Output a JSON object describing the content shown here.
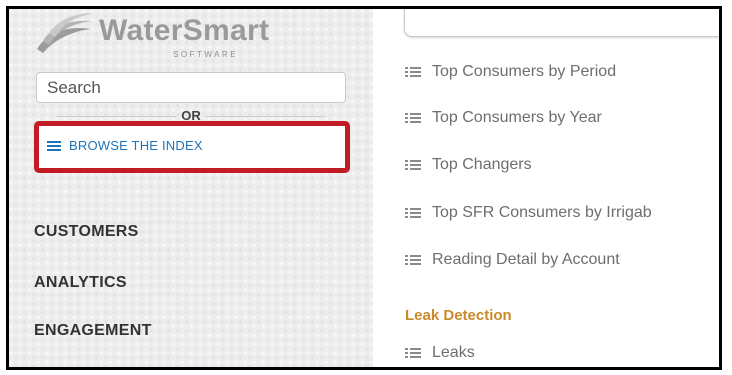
{
  "brand": {
    "name": "WaterSmart",
    "tagline": "SOFTWARE",
    "logo_icon": "water-waves-logo-icon"
  },
  "sidebar": {
    "search": {
      "placeholder": "Search",
      "value": ""
    },
    "or_label": "OR",
    "browse": {
      "label": "BROWSE THE INDEX",
      "icon": "hamburger-menu-icon",
      "highlight_color": "#c11c26",
      "link_color": "#1f73b7"
    },
    "nav": [
      {
        "label": "CUSTOMERS"
      },
      {
        "label": "ANALYTICS"
      },
      {
        "label": "ENGAGEMENT"
      }
    ]
  },
  "main": {
    "reports": [
      {
        "label": "Top Consumers by Period",
        "icon": "list-icon"
      },
      {
        "label": "Top Consumers by Year",
        "icon": "list-icon"
      },
      {
        "label": "Top Changers",
        "icon": "list-icon"
      },
      {
        "label": "Top SFR Consumers by Irrigab",
        "icon": "list-icon"
      },
      {
        "label": "Reading Detail by Account",
        "icon": "list-icon"
      }
    ],
    "section": {
      "title": "Leak Detection",
      "color": "#c98a2a"
    },
    "section_reports": [
      {
        "label": "Leaks",
        "icon": "list-icon"
      }
    ]
  }
}
